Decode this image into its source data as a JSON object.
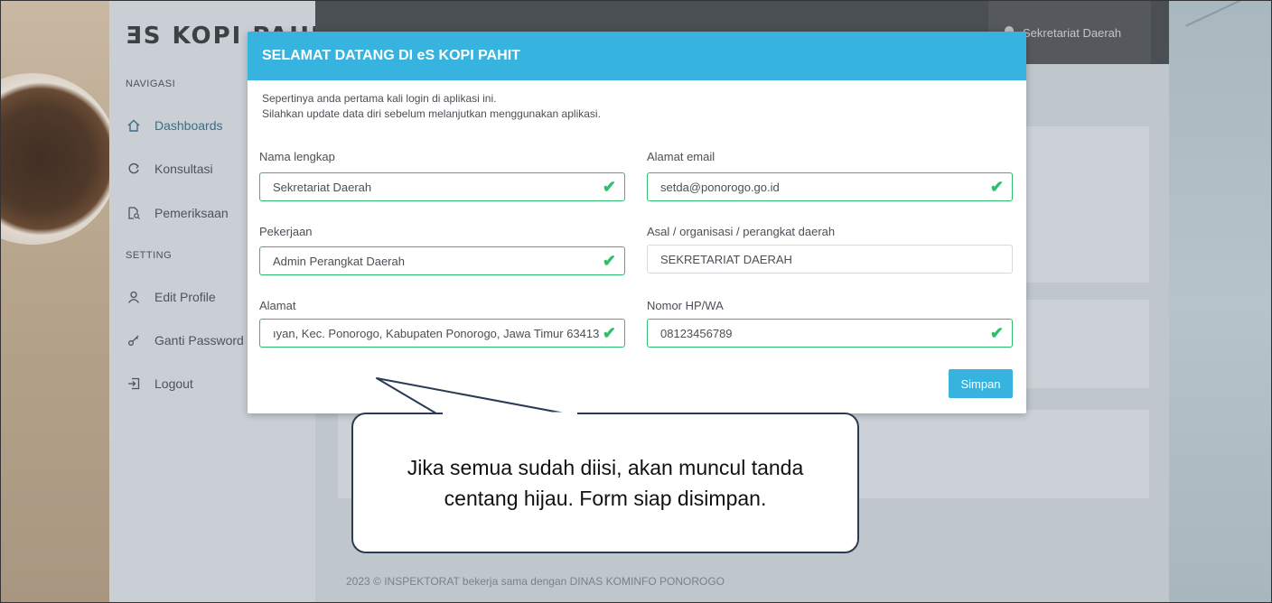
{
  "app": {
    "logo_text": "ƎS KOPI PAHIT",
    "user_name": "Sekretariat Daerah",
    "footer": "2023 © INSPEKTORAT bekerja sama dengan DINAS KOMINFO PONOROGO"
  },
  "sidebar": {
    "section_nav": "NAVIGASI",
    "section_setting": "SETTING",
    "items": [
      {
        "label": "Dashboards",
        "icon": "home-icon"
      },
      {
        "label": "Konsultasi",
        "icon": "refresh-icon"
      },
      {
        "label": "Pemeriksaan",
        "icon": "document-search-icon"
      },
      {
        "label": "Edit Profile",
        "icon": "user-icon"
      },
      {
        "label": "Ganti Password",
        "icon": "key-icon"
      },
      {
        "label": "Logout",
        "icon": "logout-icon"
      }
    ]
  },
  "modal": {
    "title": "SELAMAT DATANG DI eS KOPI PAHIT",
    "intro_line1": "Sepertinya anda pertama kali login di aplikasi ini.",
    "intro_line2": "Silahkan update data diri sebelum melanjutkan menggunakan aplikasi.",
    "fields": {
      "nama": {
        "label": "Nama lengkap",
        "value": "Sekretariat Daerah",
        "valid": true
      },
      "email": {
        "label": "Alamat email",
        "value": "setda@ponorogo.go.id",
        "valid": true
      },
      "pekerjaan": {
        "label": "Pekerjaan",
        "value": "Admin Perangkat Daerah",
        "valid": true
      },
      "asal": {
        "label": "Asal / organisasi / perangkat daerah",
        "value": "SEKRETARIAT DAERAH",
        "valid": false
      },
      "alamat": {
        "label": "Alamat",
        "value": "ıyan, Kec. Ponorogo, Kabupaten Ponorogo, Jawa Timur 63413",
        "valid": true
      },
      "hp": {
        "label": "Nomor HP/WA",
        "value": "08123456789",
        "valid": true
      }
    },
    "save_label": "Simpan",
    "check_glyph": "✔"
  },
  "callout": {
    "text": "Jika semua sudah diisi, akan muncul tanda centang hijau. Form siap disimpan."
  },
  "colors": {
    "accent": "#36b3df",
    "valid": "#2dbf6b",
    "callout_border": "#2b3a55"
  }
}
